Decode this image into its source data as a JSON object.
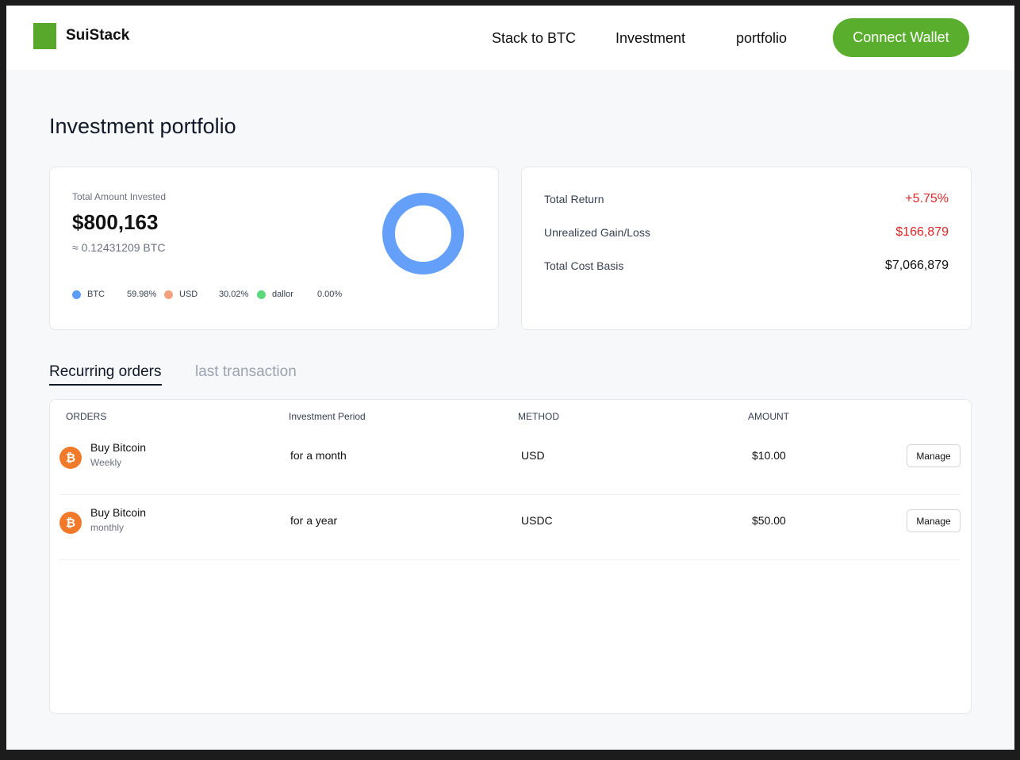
{
  "brand": {
    "name": "SuiStack",
    "color": "#58a82c"
  },
  "nav": {
    "items": [
      {
        "label": "Stack to BTC"
      },
      {
        "label": "Investment"
      },
      {
        "label": "portfolio"
      }
    ],
    "cta_label": "Connect Wallet"
  },
  "page": {
    "title": "Investment portfolio"
  },
  "summary": {
    "label": "Total Amount Invested",
    "amount": "$800,163",
    "btc_equivalent": "≈ 0.12431209 BTC",
    "allocation": [
      {
        "name": "BTC",
        "percent": "59.98%",
        "color": "#5b9cf6"
      },
      {
        "name": "USD",
        "percent": "30.02%",
        "color": "#f2a37d"
      },
      {
        "name": "dallor",
        "percent": "0.00%",
        "color": "#5dd87b"
      }
    ],
    "donut_color": "#64a0fa"
  },
  "returns": [
    {
      "label": "Total Return",
      "value": "+5.75%",
      "color": "#dc2626"
    },
    {
      "label": "Unrealized Gain/Loss",
      "value": "$166,879",
      "color": "#dc2626"
    },
    {
      "label": "Total Cost Basis",
      "value": "$7,066,879",
      "color": "#111111"
    }
  ],
  "tabs": [
    {
      "label": "Recurring orders",
      "active": true
    },
    {
      "label": "last transaction",
      "active": false
    }
  ],
  "table": {
    "headers": [
      "ORDERS",
      "Investment Period",
      "METHOD",
      "AMOUNT"
    ],
    "rows": [
      {
        "name": "Buy Bitcoin",
        "frequency": "Weekly",
        "period": "for a month",
        "method": "USD",
        "amount": "$10.00",
        "action": "Manage"
      },
      {
        "name": "Buy Bitcoin",
        "frequency": "monthly",
        "period": "for a year",
        "method": "USDC",
        "amount": "$50.00",
        "action": "Manage"
      }
    ]
  },
  "icons": {
    "coin": "bitcoin-icon",
    "coin_symbol": "₿"
  }
}
